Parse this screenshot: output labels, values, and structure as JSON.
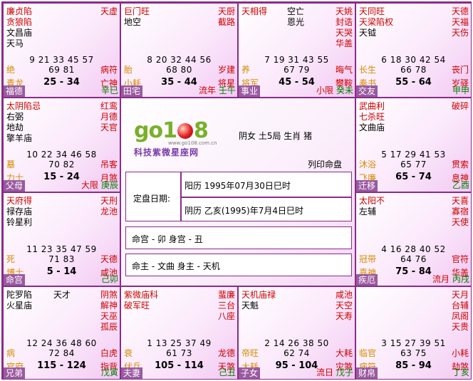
{
  "center": {
    "header": "阴女 土5局 生肖 猪",
    "chart_type": "列印命盘",
    "logo_text_left": "go1",
    "logo_text_right": "8",
    "logo_url": "www.go108.com.cn",
    "logo_subtitle": "科技紫微星座网",
    "date_label": "定盘日期:",
    "solar": "阳历 1995年07月30日巳时",
    "lunar": "阴历 乙亥(1995)年7月4日巳时",
    "ming_shen": "命宫 - 卯  身宫 - 丑",
    "zhu": "命主 - 文曲  身主 - 天机"
  },
  "palaces": [
    {
      "left": [
        "廉贞陷",
        "贪狼陷",
        "文昌庙",
        "天马"
      ],
      "left_red": [
        true,
        true,
        false,
        false
      ],
      "right": [
        "天虚"
      ],
      "extra": [],
      "nums1": "9 21 33 45 57",
      "nums2": "69 81",
      "ind_l": "绝",
      "ind_r": "病符",
      "age": "25 - 34",
      "bl": "青龙",
      "br": "亡神",
      "name": "福德",
      "flow": "",
      "stem": "辛巳"
    },
    {
      "left": [
        "巨门旺",
        "地空"
      ],
      "left_red": [
        true,
        false
      ],
      "right": [
        "天厨",
        "截路"
      ],
      "extra": [],
      "nums1": "8 20 32 44 56",
      "nums2": "68 80",
      "ind_l": "胎",
      "ind_r": "岁建",
      "age": "35 - 44",
      "bl": "小耗",
      "br": "将星",
      "name": "田宅",
      "flow": "流年",
      "stem": "壬午"
    },
    {
      "left": [
        "天相得"
      ],
      "left_red": [
        true
      ],
      "right": [
        "天姚",
        "封诰",
        "天哭",
        "华盖"
      ],
      "extra": [
        "空亡",
        "恩光"
      ],
      "nums1": "7 19 31 43 55",
      "nums2": "67 79",
      "ind_l": "养",
      "ind_r": "晦气",
      "age": "45 - 54",
      "bl": "将军",
      "br": "攀鞍",
      "name": "事业",
      "flow": "小限",
      "stem": "癸未"
    },
    {
      "left": [
        "天同旺",
        "天梁陷权",
        "天钺"
      ],
      "left_red": [
        true,
        true,
        false
      ],
      "right": [
        "天德",
        "天福",
        "天伤"
      ],
      "extra": [],
      "nums1": "6 18 30 42 54",
      "nums2": "66 78",
      "ind_l": "长生",
      "ind_r": "丧门",
      "age": "55 - 64",
      "bl": "奏书",
      "br": "岁驿",
      "name": "交友",
      "flow": "",
      "stem": "甲申"
    },
    {
      "left": [
        "太阴陷忌",
        "右弼",
        "地劫",
        "擎羊庙"
      ],
      "left_red": [
        true,
        false,
        false,
        false
      ],
      "right": [
        "红鸾",
        "月德",
        "天官"
      ],
      "extra": [],
      "nums1": "10 22 34 46 58",
      "nums2": "70 82",
      "ind_l": "墓",
      "ind_r": "吊客",
      "age": "15 - 24",
      "bl": "力士",
      "br": "月煞",
      "name": "父母",
      "flow": "大限",
      "stem": "庚辰"
    },
    {
      "left": [
        "武曲利",
        "七杀旺",
        "文曲庙"
      ],
      "left_red": [
        true,
        true,
        false
      ],
      "right": [
        "破碎"
      ],
      "extra": [],
      "nums1": "5 17 29 41 53",
      "nums2": "65 77",
      "ind_l": "沐浴",
      "ind_r": "贯索",
      "age": "65 - 74",
      "bl": "飞廉",
      "br": "息神",
      "name": "迁移",
      "flow": "",
      "stem": "乙酉"
    },
    {
      "left": [
        "天府得",
        "禄存庙",
        "铃星利"
      ],
      "left_red": [
        true,
        false,
        false
      ],
      "right": [
        "天刑",
        "龙池"
      ],
      "extra": [],
      "nums1": "11 23 35 47 59",
      "nums2": "71 83",
      "ind_l": "死",
      "ind_r": "天德",
      "age": "5 - 14",
      "bl": "博士",
      "br": "咸池",
      "name": "命宫",
      "flow": "",
      "stem": "己卯"
    },
    {
      "left": [
        "太阳不",
        "左辅"
      ],
      "left_red": [
        true,
        false
      ],
      "right": [
        "天喜",
        "寡宿",
        "天使"
      ],
      "extra": [],
      "nums1": "4 16 28 40 52",
      "nums2": "64 76",
      "ind_l": "冠带",
      "ind_r": "官符",
      "age": "75 - 84",
      "bl": "喜神",
      "br": "华盖",
      "name": "疾厄",
      "flow": "流月",
      "stem": "丙戌"
    },
    {
      "left": [
        "陀罗陷",
        "火星庙"
      ],
      "left_red": [
        false,
        false
      ],
      "right": [
        "阴煞",
        "解神",
        "天巫",
        "孤辰"
      ],
      "extra": [
        "天才"
      ],
      "nums1": "12 24 36 48 60",
      "nums2": "72 84",
      "ind_l": "病",
      "ind_r": "白虎",
      "age": "115 - 124",
      "bl": "官府",
      "br": "指背",
      "name": "兄弟",
      "flow": "",
      "stem": "戊寅"
    },
    {
      "left": [
        "紫微庙科",
        "破军旺"
      ],
      "left_red": [
        true,
        true
      ],
      "right": [
        "蜚廉",
        "三台",
        "八座"
      ],
      "extra": [],
      "nums1": "1 13 25 37 49",
      "nums2": "61 73",
      "ind_l": "衰",
      "ind_r": "龙德",
      "age": "105 - 114",
      "bl": "伏兵",
      "br": "天煞",
      "name": "夫妻",
      "flow": "",
      "stem": "己丑"
    },
    {
      "left": [
        "天机庙禄",
        "天魁"
      ],
      "left_red": [
        true,
        false
      ],
      "right": [
        "咸池",
        "天空",
        "天寿"
      ],
      "extra": [],
      "nums1": "2 14 26 38 50",
      "nums2": "62 74",
      "ind_l": "帝旺",
      "ind_r": "大耗",
      "age": "95 - 104",
      "bl": "大耗",
      "br": "灾煞",
      "name": "子女",
      "flow": "流日",
      "stem": "戊子"
    },
    {
      "left": [],
      "left_red": [],
      "right": [
        "天月",
        "台辅",
        "凤阁",
        "天贵"
      ],
      "extra": [],
      "nums1": "3 15 27 39 51",
      "nums2": "63 75",
      "ind_l": "临官",
      "ind_r": "小耗",
      "age": "85 - 94",
      "bl": "病符",
      "br": "劫煞",
      "name": "财帛",
      "flow": "",
      "stem": "丁亥"
    }
  ]
}
